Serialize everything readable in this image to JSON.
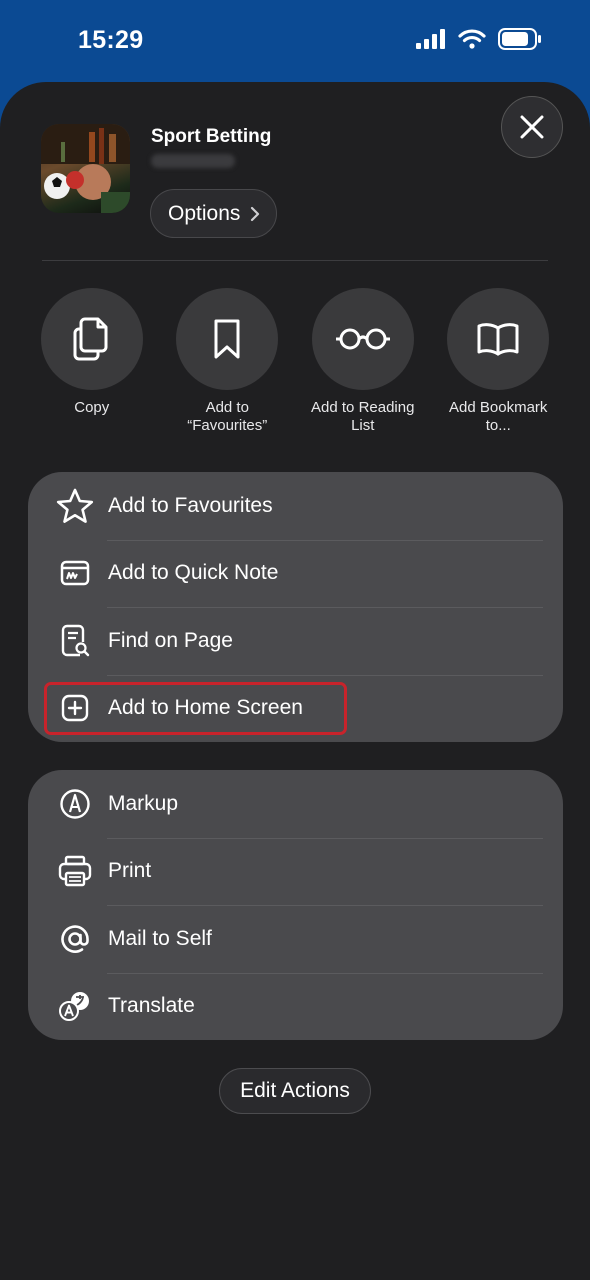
{
  "status_bar": {
    "time": "15:29",
    "icons": [
      "cellular-signal-icon",
      "wifi-icon",
      "battery-icon"
    ]
  },
  "header": {
    "site_title": "Sport Betting",
    "options_label": "Options"
  },
  "quick_actions": [
    {
      "label": "Copy",
      "icon": "copy-icon"
    },
    {
      "label": "Add to\n“Favourites”",
      "icon": "bookmark-icon"
    },
    {
      "label": "Add to Reading\nList",
      "icon": "glasses-icon"
    },
    {
      "label": "Add Bookmark\nto...",
      "icon": "book-icon"
    }
  ],
  "menu_group_1": [
    {
      "label": "Add to Favourites",
      "icon": "star-icon"
    },
    {
      "label": "Add to Quick Note",
      "icon": "quick-note-icon"
    },
    {
      "label": "Find on Page",
      "icon": "find-on-page-icon"
    },
    {
      "label": "Add to Home Screen",
      "icon": "plus-square-icon"
    }
  ],
  "menu_group_2": [
    {
      "label": "Markup",
      "icon": "markup-icon"
    },
    {
      "label": "Print",
      "icon": "printer-icon"
    },
    {
      "label": "Mail to Self",
      "icon": "at-icon"
    },
    {
      "label": "Translate",
      "icon": "translate-icon"
    }
  ],
  "footer": {
    "edit_actions_label": "Edit Actions"
  },
  "colors": {
    "background": "#0b4a93",
    "sheet": "#1f1f21",
    "group": "#4a4a4d",
    "highlight": "#c8232b"
  }
}
